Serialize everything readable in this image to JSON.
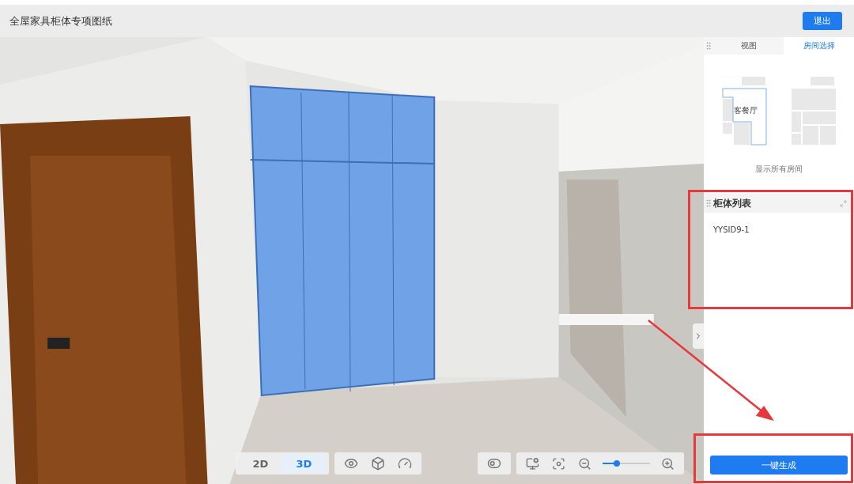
{
  "header": {
    "title": "全屋家具柜体专项图纸",
    "exit_button": "退出"
  },
  "panel": {
    "tabs": [
      {
        "label": "视图",
        "selected": false
      },
      {
        "label": "房间选择",
        "selected": true
      }
    ],
    "rooms": [
      {
        "label": "客餐厅",
        "selected": true
      },
      {
        "selected": false
      }
    ],
    "show_all": "显示所有房间",
    "cabinet_list": {
      "title": "柜体列表",
      "items": [
        "YYSID9-1"
      ]
    },
    "generate_button": "一键生成"
  },
  "toolbar": {
    "modes": [
      {
        "label": "2D",
        "selected": false
      },
      {
        "label": "3D",
        "selected": true
      }
    ],
    "zoom": {
      "level": 0.3
    }
  }
}
